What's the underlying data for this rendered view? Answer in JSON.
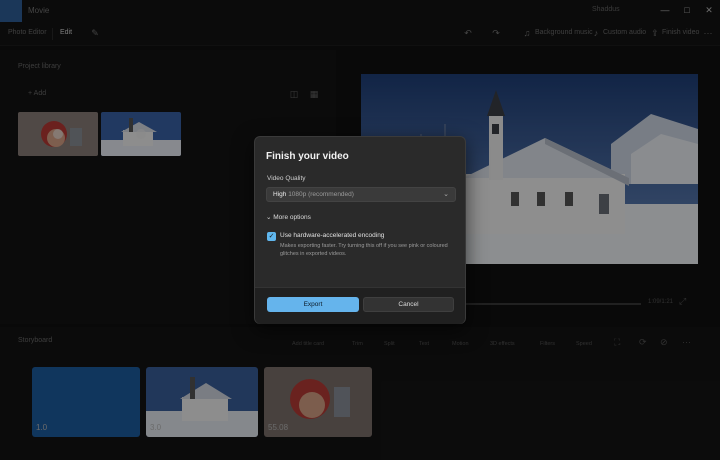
{
  "app": {
    "title": "Movie",
    "user": "Shaddus"
  },
  "window_controls": {
    "minimize": "—",
    "maximize": "□",
    "close": "✕"
  },
  "toolbar": {
    "project_name": "Photo Editor",
    "tab_active": "Edit",
    "background_music": "Background music",
    "custom_audio": "Custom audio",
    "finish_video": "Finish video",
    "more": "···"
  },
  "library": {
    "title": "Project library",
    "add_label": "+ Add"
  },
  "preview": {
    "time": "1:09/1:21"
  },
  "storyboard": {
    "title": "Storyboard",
    "tools": [
      "Add title card",
      "Trim",
      "Split",
      "Text",
      "Motion",
      "3D effects",
      "Filters",
      "Speed"
    ],
    "clips": [
      {
        "duration": "1.0"
      },
      {
        "duration": "3.0"
      },
      {
        "duration": "55.08"
      }
    ]
  },
  "dialog": {
    "title": "Finish your video",
    "quality_label": "Video Quality",
    "quality_value": "High",
    "quality_detail": "1080p (recommended)",
    "more_options": "More options",
    "hw_checked": true,
    "hw_label": "Use hardware-accelerated encoding",
    "hw_desc": "Makes exporting faster. Try turning this off if you see pink or coloured glitches in exported videos.",
    "export_label": "Export",
    "cancel_label": "Cancel"
  },
  "colors": {
    "accent": "#65b4ec",
    "dialog_bg": "#2a2a2a",
    "app_bg": "#101010"
  },
  "icons": {
    "undo": "undo-icon",
    "redo": "redo-icon",
    "pen": "pen-icon",
    "music": "music-icon",
    "expand": "expand-icon"
  }
}
